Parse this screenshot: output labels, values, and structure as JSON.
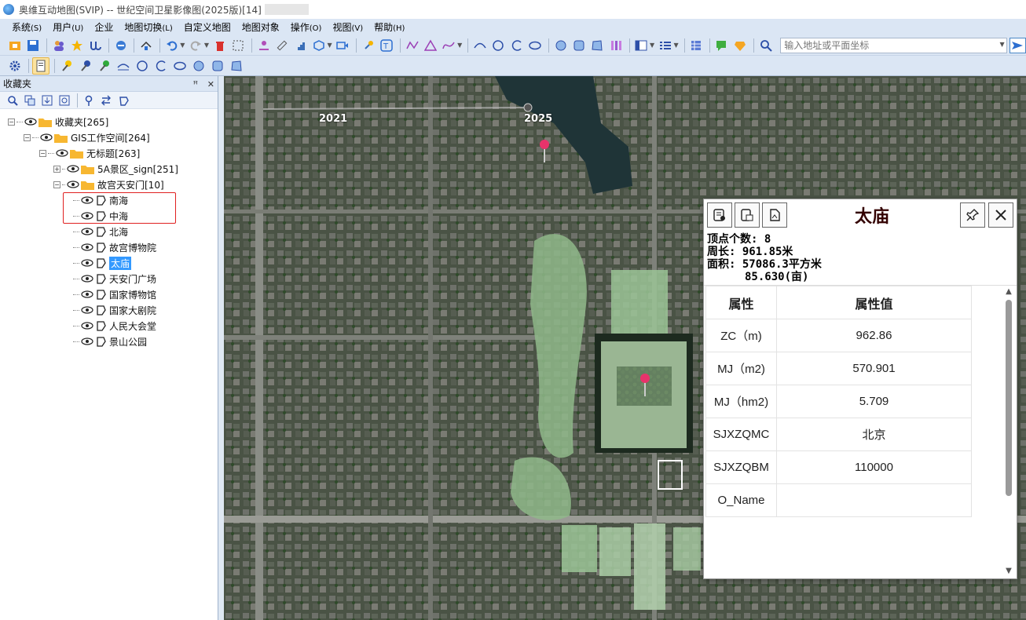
{
  "window": {
    "title": "奥维互动地图(SVIP) -- 世纪空间卫星影像图(2025版)[14]"
  },
  "menu": [
    {
      "label": "系统",
      "key": "(S)"
    },
    {
      "label": "用户",
      "key": "(U)"
    },
    {
      "label": "企业",
      "key": ""
    },
    {
      "label": "地图切换",
      "key": "(L)"
    },
    {
      "label": "自定义地图",
      "key": ""
    },
    {
      "label": "地图对象",
      "key": ""
    },
    {
      "label": "操作",
      "key": "(O)"
    },
    {
      "label": "视图",
      "key": "(V)"
    },
    {
      "label": "帮助",
      "key": "(H)"
    }
  ],
  "search": {
    "placeholder": "输入地址或平面坐标"
  },
  "sidebar": {
    "title": "收藏夹",
    "pin_glyph": "ꟸ",
    "close_glyph": "✕",
    "tree": {
      "root": "收藏夹[265]",
      "workspace": "GIS工作空间[264]",
      "untitled": "无标题[263]",
      "folder_5a": "5A景区_sign[251]",
      "folder_gugong": "故宫天安门[10]",
      "items": [
        "南海",
        "中海",
        "北海",
        "故宫博物院",
        "太庙",
        "天安门广场",
        "国家博物馆",
        "国家大剧院",
        "人民大会堂",
        "景山公园"
      ],
      "selected": "太庙"
    }
  },
  "map": {
    "timeline": {
      "start": "2021",
      "end": "2025"
    }
  },
  "panel": {
    "title": "太庙",
    "stats": {
      "vertices": "顶点个数: 8",
      "perimeter": "周长: 961.85米",
      "area": "面积: 57086.3平方米",
      "area_mu": "85.630(亩)"
    },
    "table": {
      "header_key": "属性",
      "header_value": "属性值",
      "rows": [
        {
          "key": "ZC（m)",
          "value": "962.86"
        },
        {
          "key": "MJ（m2)",
          "value": "570.901"
        },
        {
          "key": "MJ（hm2)",
          "value": "5.709"
        },
        {
          "key": "SJXZQMC",
          "value": "北京"
        },
        {
          "key": "SJXZQBM",
          "value": "110000"
        },
        {
          "key": "O_Name",
          "value": ""
        }
      ]
    }
  },
  "colors": {
    "accent": "#3399ff",
    "ribbon": "#dbe6f4",
    "marker": "#e8336b",
    "highlight_border": "#e02020"
  }
}
